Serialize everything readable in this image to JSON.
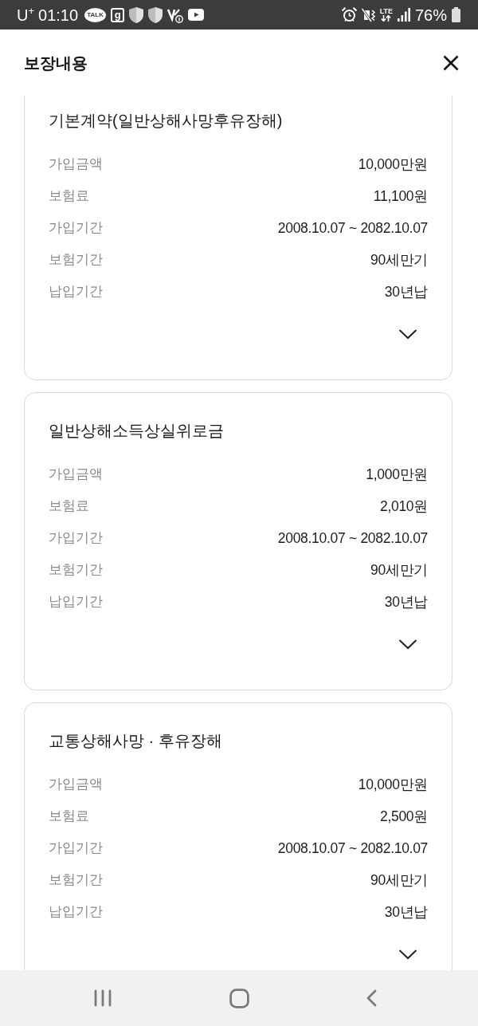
{
  "status_bar": {
    "carrier": "U$^{+}$",
    "time": "01:10",
    "notifications": [
      {
        "kind": "chat",
        "label": "TALK"
      },
      {
        "kind": "letter",
        "label": "g"
      },
      {
        "kind": "shield"
      },
      {
        "kind": "shield"
      },
      {
        "kind": "call"
      },
      {
        "kind": "play"
      }
    ],
    "indicators": [
      {
        "kind": "alarm"
      },
      {
        "kind": "mute"
      },
      {
        "kind": "network",
        "label": "LTE"
      },
      {
        "kind": "signal"
      }
    ],
    "battery": "76%"
  },
  "header": {
    "title": "보장내용"
  },
  "coverages": [
    {
      "title": "기본계약(일반상해사망후유장해)",
      "expanded": false,
      "rows": [
        {
          "label": "가입금액",
          "value": "10,000만원"
        },
        {
          "label": "보험료",
          "value": "11,100원"
        },
        {
          "label": "가입기간",
          "value": "2008.10.07 ~ 2082.10.07"
        },
        {
          "label": "보험기간",
          "value": "90세만기"
        },
        {
          "label": "납입기간",
          "value": "30년납"
        }
      ]
    },
    {
      "title": "일반상해소득상실위로금",
      "expanded": false,
      "rows": [
        {
          "label": "가입금액",
          "value": "1,000만원"
        },
        {
          "label": "보험료",
          "value": "2,010원"
        },
        {
          "label": "가입기간",
          "value": "2008.10.07 ~ 2082.10.07"
        },
        {
          "label": "보험기간",
          "value": "90세만기"
        },
        {
          "label": "납입기간",
          "value": "30년납"
        }
      ]
    },
    {
      "title": "교통상해사망 · 후유장해",
      "expanded": false,
      "rows": [
        {
          "label": "가입금액",
          "value": "10,000만원"
        },
        {
          "label": "보험료",
          "value": "2,500원"
        },
        {
          "label": "가입기간",
          "value": "2008.10.07 ~ 2082.10.07"
        },
        {
          "label": "보험기간",
          "value": "90세만기"
        },
        {
          "label": "납입기간",
          "value": "30년납"
        }
      ]
    }
  ]
}
